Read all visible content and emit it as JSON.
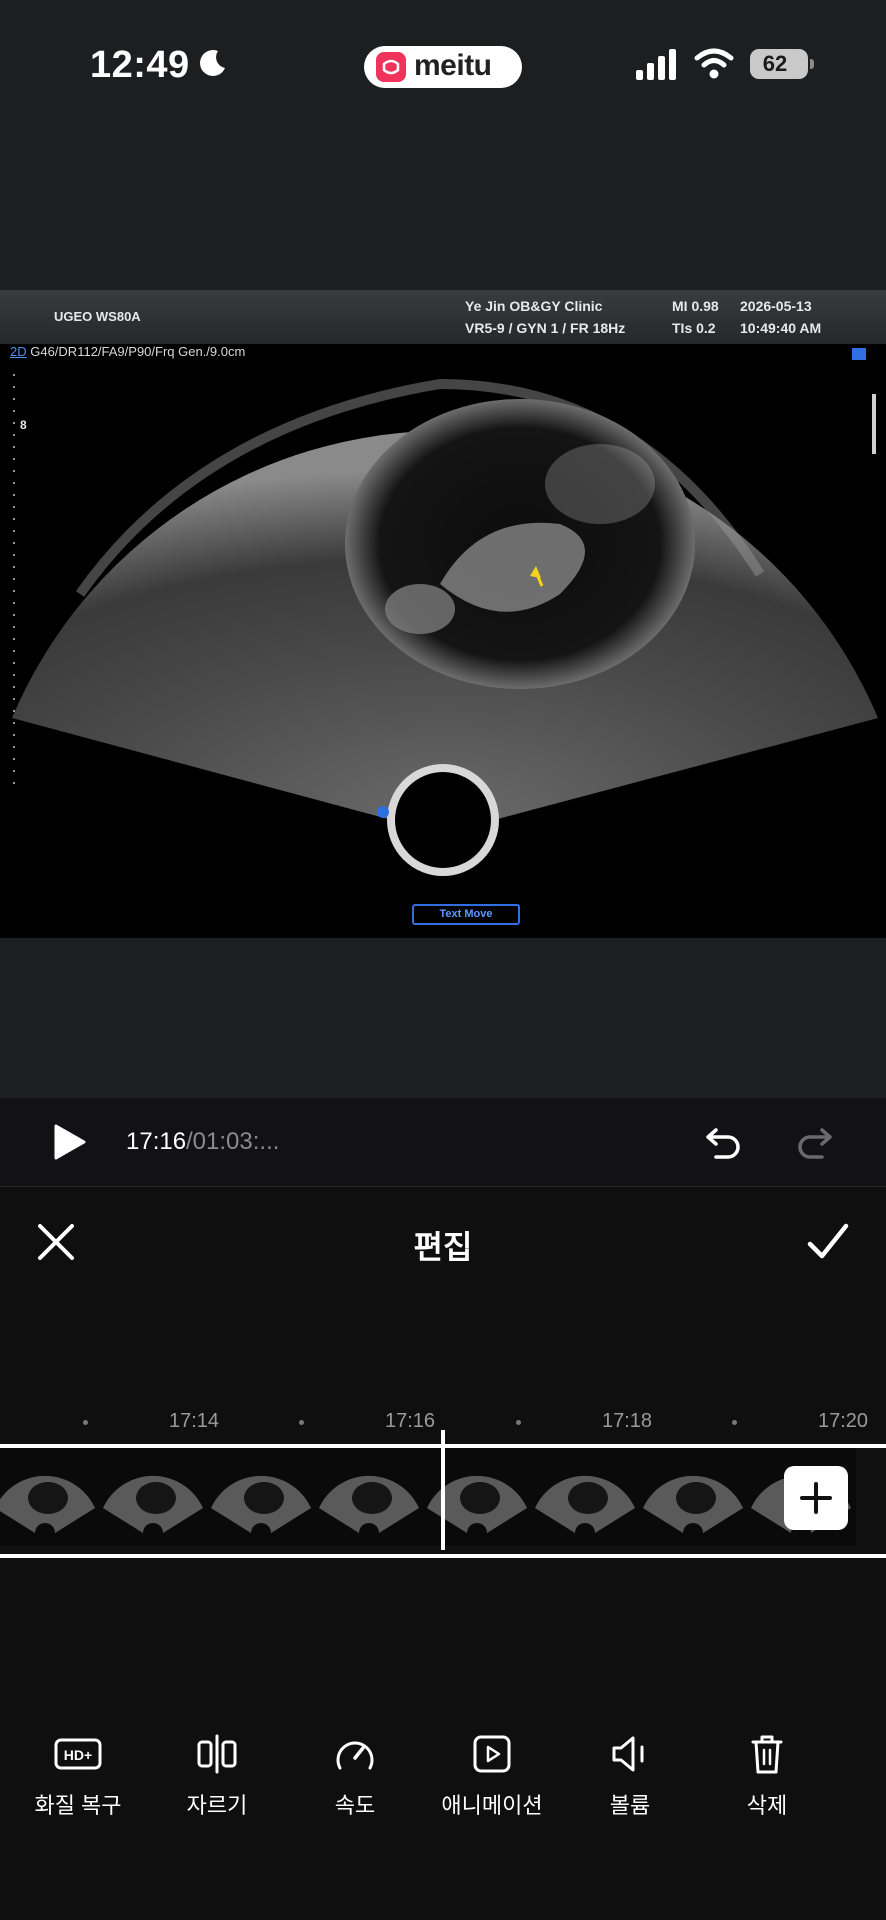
{
  "status_bar": {
    "time": "12:49",
    "app_name": "meitu",
    "battery": "62",
    "icons": [
      "moon-icon",
      "signal-icon",
      "wifi-icon",
      "battery-icon"
    ]
  },
  "ultrasound": {
    "device": "UGEO WS80A",
    "clinic": "Ye Jin OB&GY Clinic",
    "probe": "VR5-9 / GYN 1 / FR 18Hz",
    "mi": "MI  0.98",
    "tis": "TIs 0.2",
    "date": "2026-05-13",
    "clock": "10:49:40 AM",
    "mode_prefix": "2D",
    "mode_params": " G46/DR112/FA9/P90/Frq Gen./9.0cm",
    "depth_mark": "8",
    "text_move": "Text Move"
  },
  "player": {
    "current": "17:16",
    "total": "/01:03:..."
  },
  "editor": {
    "title": "편집"
  },
  "timeline": {
    "labels": [
      "17:14",
      "17:16",
      "17:18",
      "17:20"
    ]
  },
  "tools": [
    {
      "label": "화질 복구",
      "icon": "hd-plus-icon"
    },
    {
      "label": "자르기",
      "icon": "split-icon"
    },
    {
      "label": "속도",
      "icon": "speed-gauge-icon"
    },
    {
      "label": "애니메이션",
      "icon": "animation-play-icon"
    },
    {
      "label": "볼륨",
      "icon": "volume-icon"
    },
    {
      "label": "삭제",
      "icon": "trash-icon"
    }
  ],
  "colors": {
    "background": "#0f0f10",
    "app_brand": "#f0335a",
    "ultrasound_blue": "#2f6fe3",
    "arrow_yellow": "#f2d21b"
  }
}
